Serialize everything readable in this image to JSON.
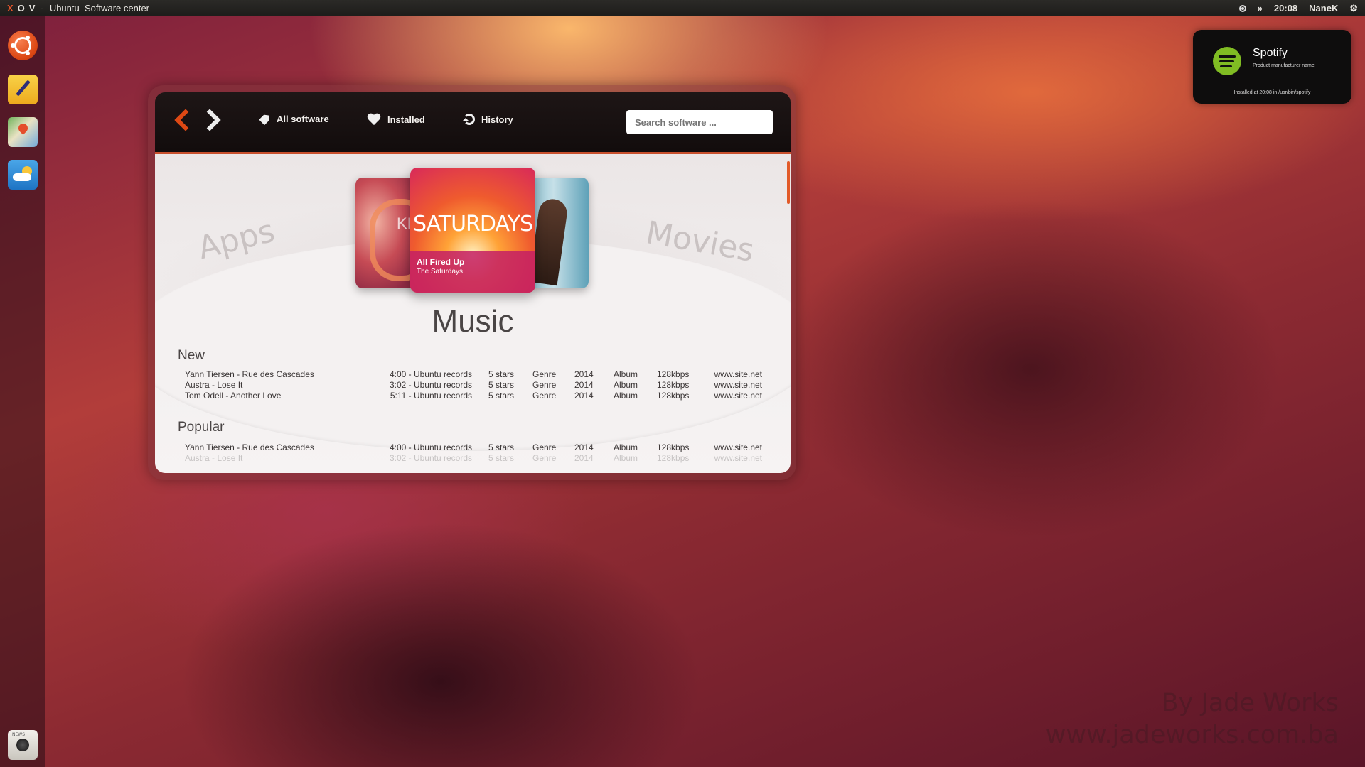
{
  "top_panel": {
    "window_controls": [
      "X",
      "O",
      "V"
    ],
    "separator": "-",
    "title": "Ubuntu  Software center",
    "time": "20:08",
    "user": "NaneK"
  },
  "launcher": {
    "items": [
      "ubuntu-logo-icon",
      "notes-icon",
      "maps-icon",
      "weather-icon",
      "news-camera-icon"
    ],
    "news_caption": "NEWS"
  },
  "notification": {
    "app_name": "Spotify",
    "subtitle": "Product manufacturer name",
    "footer": "Installed at 20:08 in /usr/bin/spotify",
    "logo_color": "#80bc23"
  },
  "toolbar": {
    "nav": [
      {
        "label": "All software",
        "icon": "tag-icon"
      },
      {
        "label": "Installed",
        "icon": "heart-icon"
      },
      {
        "label": "History",
        "icon": "refresh-icon"
      }
    ],
    "search_placeholder": "Search software ...",
    "accent": "#dd4814"
  },
  "carousel": {
    "left_category": "Apps",
    "right_category": "Movies",
    "left_cover_text": "KI",
    "featured": {
      "logo_text": "SATURDAYS",
      "title": "All Fired Up",
      "artist": "The Saturdays"
    }
  },
  "section": {
    "title": "Music",
    "groups": [
      {
        "title": "New",
        "rows": [
          {
            "name": "Yann Tiersen - Rue des Cascades",
            "duration": "4:00 - Ubuntu records",
            "rating": "5 stars",
            "genre": "Genre",
            "year": "2014",
            "album": "Album",
            "bitrate": "128kbps",
            "site": "www.site.net"
          },
          {
            "name": "Austra - Lose It",
            "duration": "3:02 - Ubuntu records",
            "rating": "5 stars",
            "genre": "Genre",
            "year": "2014",
            "album": "Album",
            "bitrate": "128kbps",
            "site": "www.site.net"
          },
          {
            "name": "Tom Odell - Another Love",
            "duration": "5:11 - Ubuntu records",
            "rating": "5 stars",
            "genre": "Genre",
            "year": "2014",
            "album": "Album",
            "bitrate": "128kbps",
            "site": "www.site.net"
          }
        ]
      },
      {
        "title": "Popular",
        "rows": [
          {
            "name": "Yann Tiersen - Rue des Cascades",
            "duration": "4:00 - Ubuntu records",
            "rating": "5 stars",
            "genre": "Genre",
            "year": "2014",
            "album": "Album",
            "bitrate": "128kbps",
            "site": "www.site.net"
          },
          {
            "name": "Austra - Lose It",
            "duration": "3:02 - Ubuntu records",
            "rating": "5 stars",
            "genre": "Genre",
            "year": "2014",
            "album": "Album",
            "bitrate": "128kbps",
            "site": "www.site.net"
          }
        ]
      }
    ]
  },
  "watermark": {
    "line1": "By Jade Works",
    "line2": "www.jadeworks.com.ba"
  }
}
